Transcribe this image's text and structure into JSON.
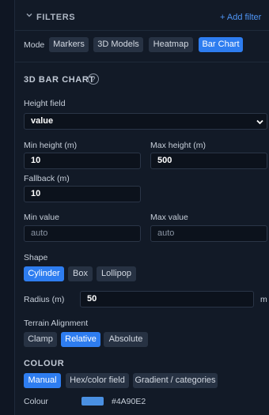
{
  "filters": {
    "title": "FILTERS",
    "add_label": "+ Add filter"
  },
  "mode": {
    "label": "Mode",
    "options": [
      "Markers",
      "3D Models",
      "Heatmap",
      "Bar Chart"
    ],
    "selected": "Bar Chart"
  },
  "bar_chart": {
    "title": "3D BAR CHART",
    "help_glyph": "?",
    "height_field_label": "Height field",
    "height_field_value": "value",
    "min_height_label": "Min height (m)",
    "min_height_value": "10",
    "max_height_label": "Max height (m)",
    "max_height_value": "500",
    "fallback_label": "Fallback (m)",
    "fallback_value": "10",
    "min_value_label": "Min value",
    "min_value_placeholder": "auto",
    "max_value_label": "Max value",
    "max_value_placeholder": "auto",
    "shape_label": "Shape",
    "shape_options": [
      "Cylinder",
      "Box",
      "Lollipop"
    ],
    "shape_selected": "Cylinder",
    "radius_label": "Radius (m)",
    "radius_value": "50",
    "radius_unit": "m",
    "terrain_label": "Terrain Alignment",
    "terrain_options": [
      "Clamp",
      "Relative",
      "Absolute"
    ],
    "terrain_selected": "Relative"
  },
  "colour": {
    "title": "COLOUR",
    "mode_options": [
      "Manual",
      "Hex/color field",
      "Gradient / categories"
    ],
    "mode_selected": "Manual",
    "colour_label": "Colour",
    "colour_value": "#4A90E2",
    "swatch_color": "#4A90E2"
  },
  "colors": {
    "accent": "#2E7DF0",
    "background": "#121A27"
  }
}
